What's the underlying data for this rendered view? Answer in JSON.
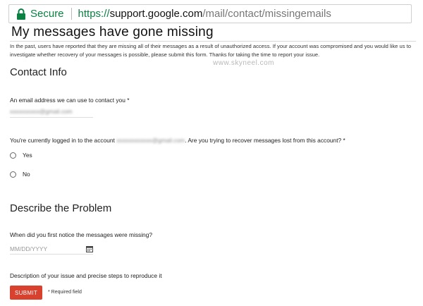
{
  "address_bar": {
    "secure_label": "Secure",
    "url_scheme": "https://",
    "url_host": "support.google.com",
    "url_path": "/mail/contact/missingemails",
    "secure_color": "#0b8043"
  },
  "page": {
    "title": "My messages have gone missing",
    "intro": "In the past, users have reported that they are missing all of their messages as a result of unauthorized access. If your account was compromised and you would like us to investigate whether recovery of your messages is possible, please submit this form. Thanks for taking the time to report your issue.",
    "watermark": "www.skyneel.com"
  },
  "contact_info": {
    "heading": "Contact Info",
    "email_label": "An email address we can use to contact you *",
    "email_value": "xxxxxxxxxx@gmail.com",
    "logged_in_prefix": "You're currently logged in to the account",
    "logged_in_account": "xxxxxxxxxxxx@gmail.com",
    "logged_in_suffix": ". Are you trying to recover messages lost from this account? *",
    "options": [
      "Yes",
      "No"
    ]
  },
  "problem": {
    "heading": "Describe the Problem",
    "date_label": "When did you first notice the messages were missing?",
    "date_placeholder": "MM/DD/YYYY",
    "description_label": "Description of your issue and precise steps to reproduce it"
  },
  "footer": {
    "submit_label": "SUBMIT",
    "required_note": "* Required field",
    "submit_color": "#d9412f"
  },
  "icons": {
    "lock": "lock-icon",
    "calendar": "calendar-icon"
  }
}
